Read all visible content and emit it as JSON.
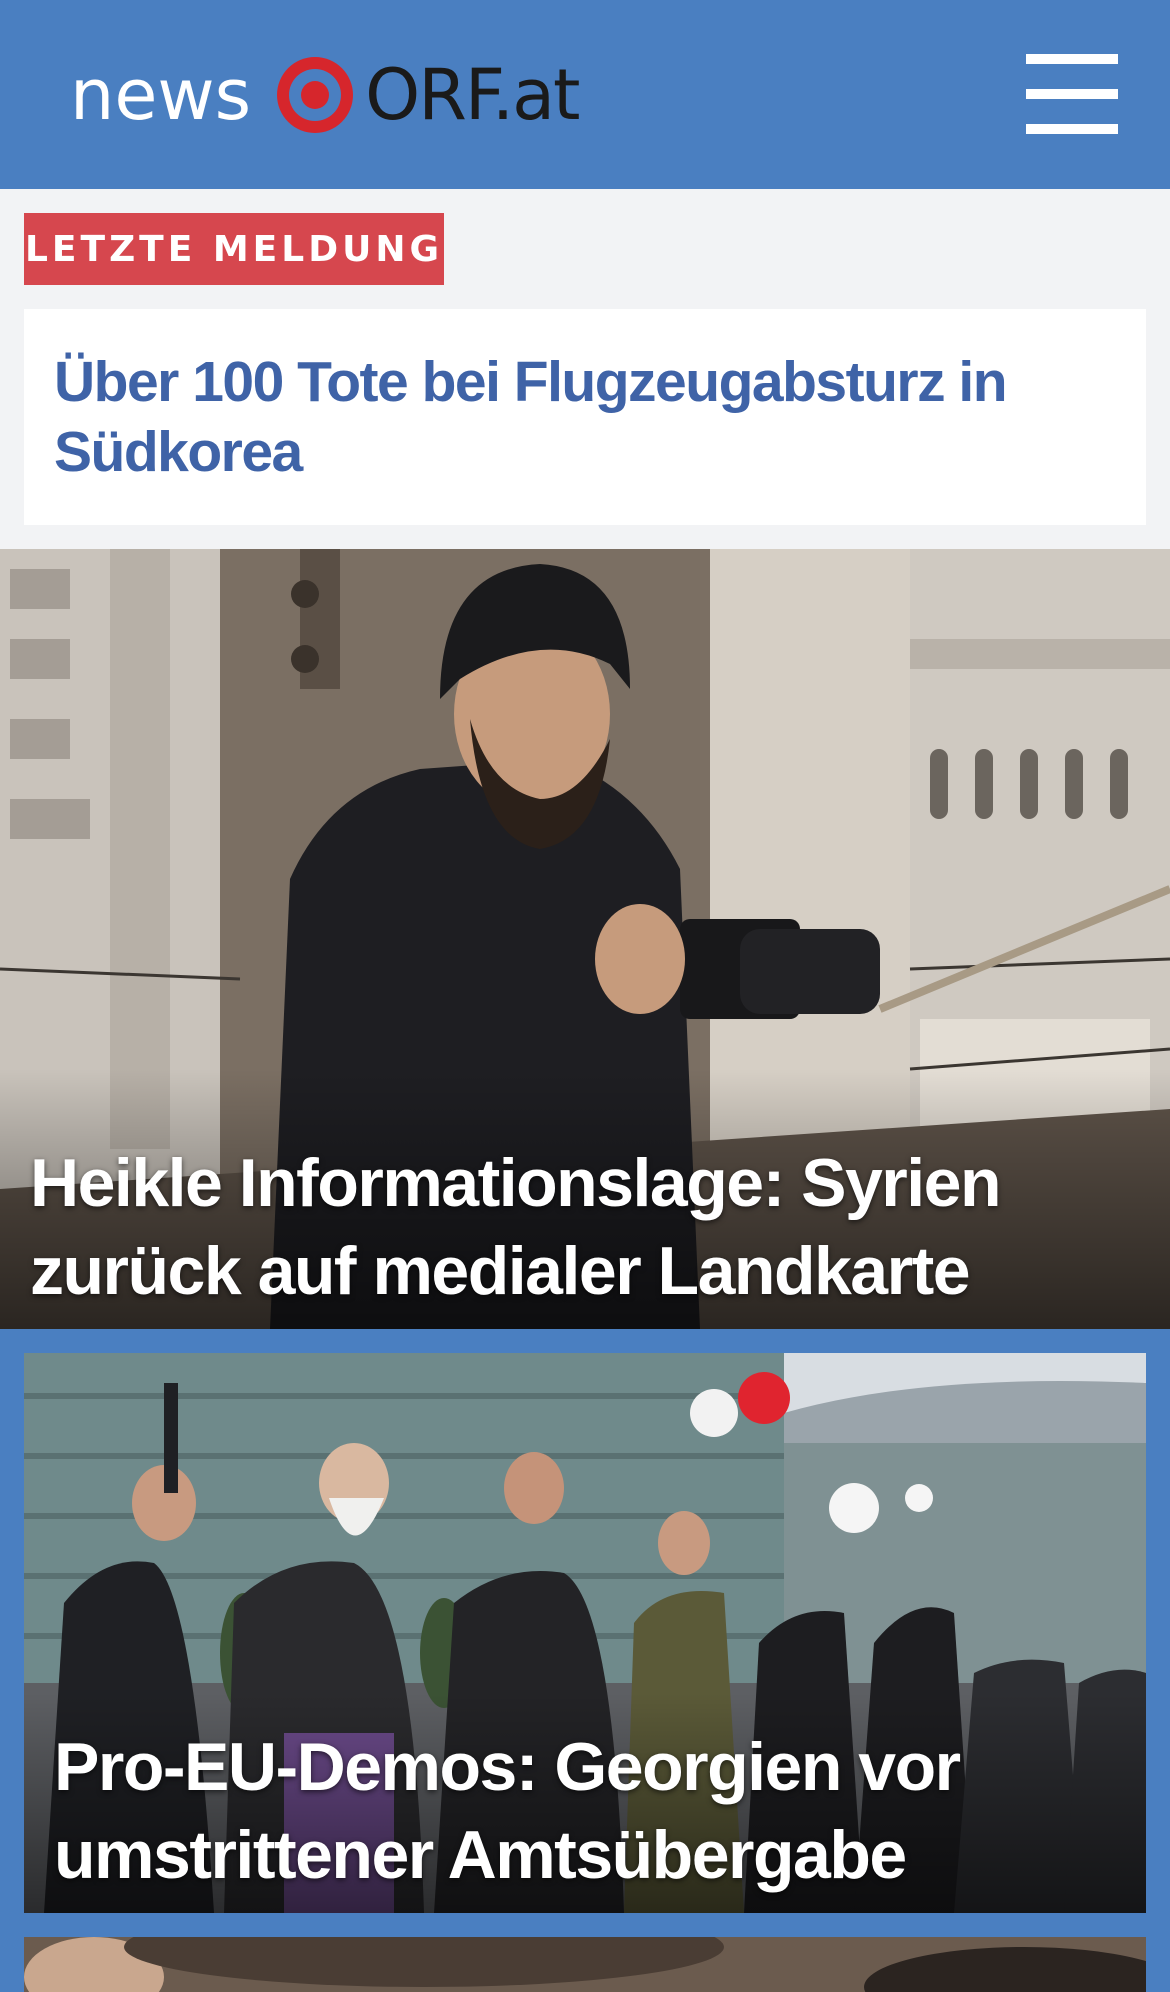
{
  "header": {
    "logo_news": "news",
    "logo_orf": "ORF.at",
    "logo_icon": "orf-target-icon",
    "menu_icon": "hamburger-menu-icon",
    "background": "#4a7fc1"
  },
  "breaking": {
    "badge_label": "LETZTE MELDUNG",
    "badge_color": "#d6474e",
    "title": "Über 100 Tote bei Flugzeugabsturz in Südkorea",
    "title_color": "#3f63a7"
  },
  "stories": [
    {
      "title": "Heikle Informationslage: Syrien zurück auf medialer Landkarte"
    },
    {
      "title": "Pro-EU-Demos: Georgien vor umstrittener Amtsübergabe"
    }
  ]
}
